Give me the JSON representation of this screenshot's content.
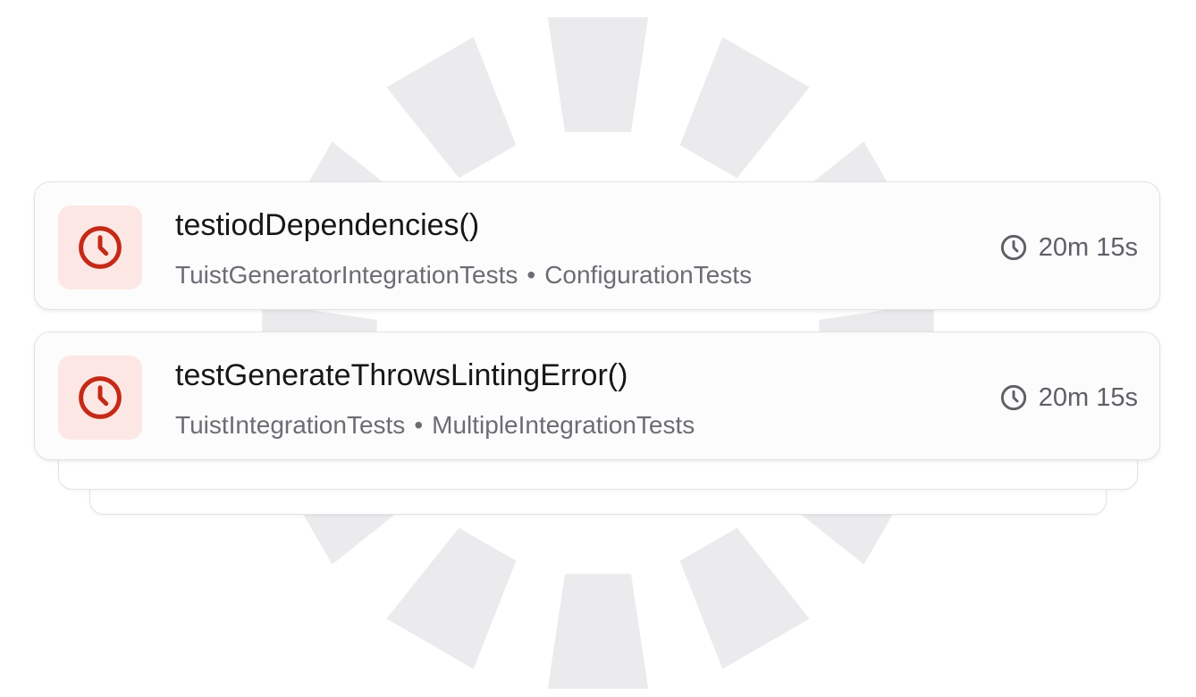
{
  "colors": {
    "failure_accent": "#c42a17",
    "failure_tile_bg": "#fde7e4",
    "spinner_segment": "#ebebed"
  },
  "tests": [
    {
      "name": "testiodDependencies()",
      "module": "TuistGeneratorIntegrationTests",
      "separator": "•",
      "suite": "ConfigurationTests",
      "duration": "20m 15s",
      "status_icon": "clock-icon",
      "duration_icon": "clock-icon"
    },
    {
      "name": "testGenerateThrowsLintingError()",
      "module": "TuistIntegrationTests",
      "separator": "•",
      "suite": "MultipleIntegrationTests",
      "duration": "20m 15s",
      "status_icon": "clock-icon",
      "duration_icon": "clock-icon"
    }
  ]
}
